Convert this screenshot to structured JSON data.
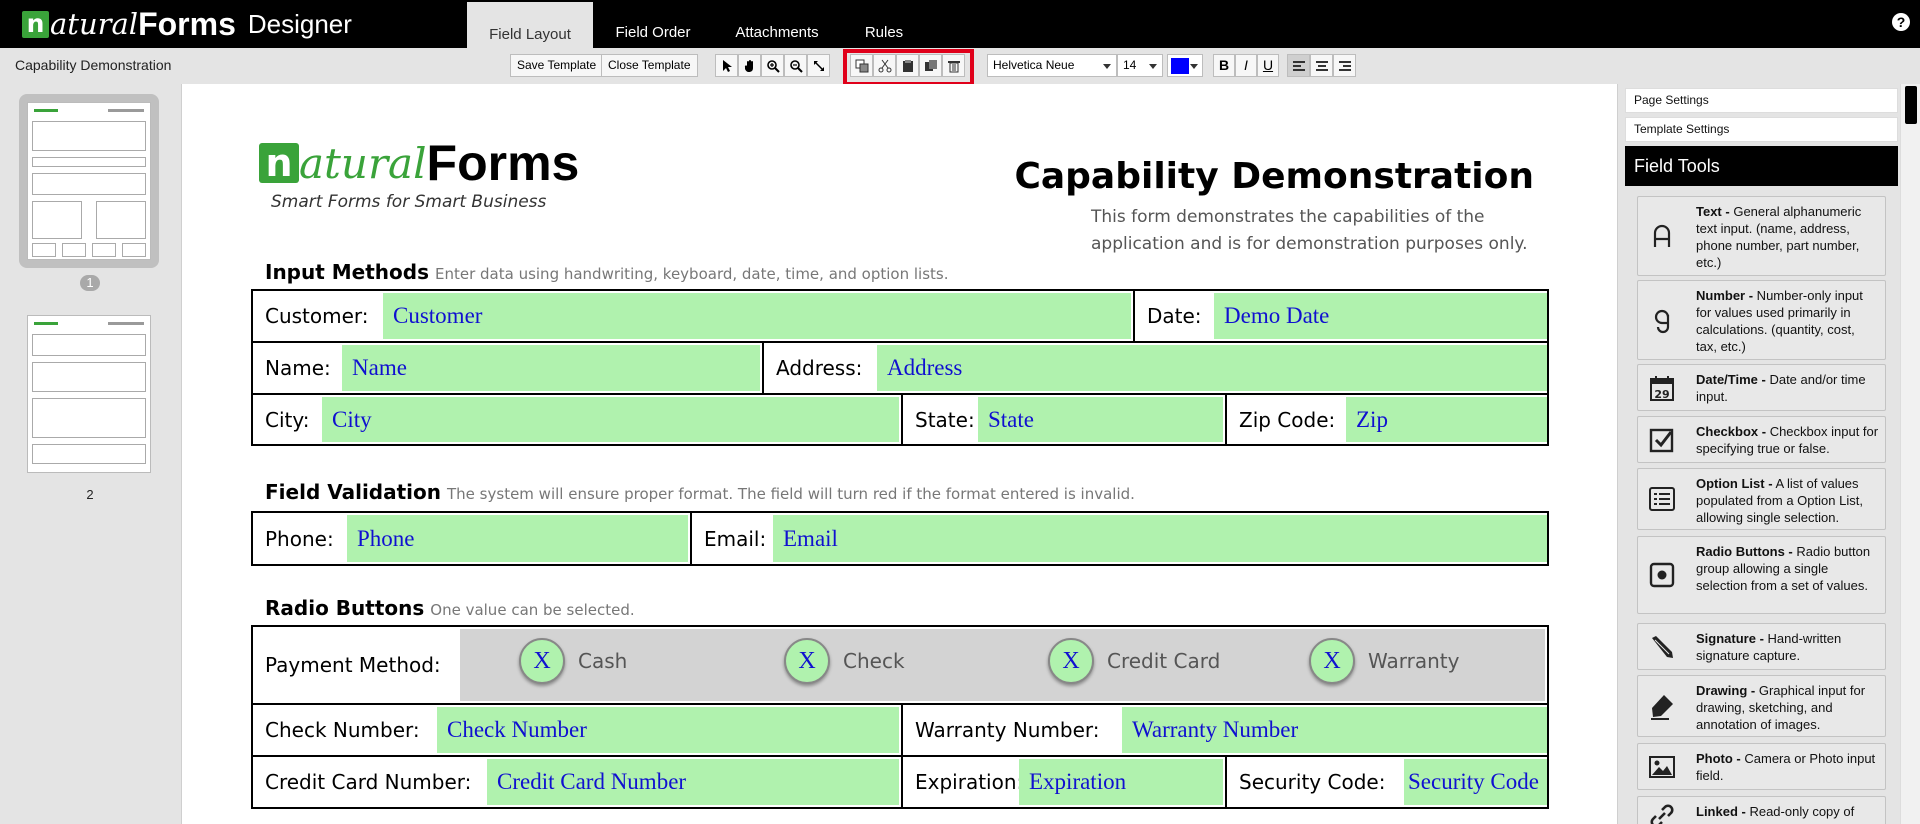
{
  "header": {
    "logo": {
      "n": "n",
      "atural": "atural",
      "forms": "Forms",
      "designer": "Designer"
    },
    "tabs": [
      {
        "label": "Field Layout",
        "active": true
      },
      {
        "label": "Field Order",
        "active": false
      },
      {
        "label": "Attachments",
        "active": false
      },
      {
        "label": "Rules",
        "active": false
      }
    ],
    "help_icon": "question-gear-icon"
  },
  "toolbar": {
    "document_title": "Capability Demonstration",
    "save_template": "Save Template",
    "close_template": "Close Template",
    "tools": [
      "pointer-icon",
      "hand-pan-icon",
      "zoom-in-icon",
      "zoom-out-icon",
      "fit-icon"
    ],
    "edit_tools": [
      "copy-icon",
      "cut-icon",
      "paste-icon",
      "duplicate-icon",
      "delete-icon"
    ],
    "font_family": "Helvetica Neue",
    "font_size": "14",
    "font_color": "#0000ff",
    "bold": "B",
    "italic": "I",
    "underline": "U",
    "align": [
      "align-left-icon",
      "align-center-icon",
      "align-right-icon"
    ]
  },
  "pages": [
    {
      "number": "1",
      "selected": true
    },
    {
      "number": "2",
      "selected": false
    }
  ],
  "form": {
    "logo": {
      "n": "n",
      "atural": "atural",
      "forms": "Forms",
      "tagline": "Smart Forms for Smart Business"
    },
    "title": "Capability Demonstration",
    "description": "This form demonstrates the capabilities of the application and is for demonstration purposes only.",
    "sections": {
      "input_methods": {
        "title": "Input Methods",
        "subtitle": "Enter data using handwriting, keyboard, date, time, and option lists."
      },
      "field_validation": {
        "title": "Field Validation",
        "subtitle": "The system will ensure proper format. The field will turn red if the format entered is invalid."
      },
      "radio_buttons": {
        "title": "Radio Buttons",
        "subtitle": "One value can be selected."
      }
    },
    "fields": {
      "customer": {
        "label": "Customer:",
        "value": "Customer"
      },
      "date": {
        "label": "Date:",
        "value": "Demo Date"
      },
      "name": {
        "label": "Name:",
        "value": "Name"
      },
      "address": {
        "label": "Address:",
        "value": "Address"
      },
      "city": {
        "label": "City:",
        "value": "City"
      },
      "state": {
        "label": "State:",
        "value": "State"
      },
      "zip": {
        "label": "Zip Code:",
        "value": "Zip"
      },
      "phone": {
        "label": "Phone:",
        "value": "Phone"
      },
      "email": {
        "label": "Email:",
        "value": "Email"
      },
      "payment_method": {
        "label": "Payment Method:"
      },
      "check_number": {
        "label": "Check Number:",
        "value": "Check Number"
      },
      "warranty_number": {
        "label": "Warranty Number:",
        "value": "Warranty Number"
      },
      "credit_card_number": {
        "label": "Credit Card Number:",
        "value": "Credit Card Number"
      },
      "expiration": {
        "label": "Expiration:",
        "value": "Expiration"
      },
      "security_code": {
        "label": "Security Code:",
        "value": "Security Code"
      }
    },
    "radio_options": [
      {
        "mark": "X",
        "label": "Cash"
      },
      {
        "mark": "X",
        "label": "Check"
      },
      {
        "mark": "X",
        "label": "Credit Card"
      },
      {
        "mark": "X",
        "label": "Warranty"
      }
    ]
  },
  "right_panel": {
    "page_settings": "Page Settings",
    "template_settings": "Template Settings",
    "field_tools_title": "Field Tools",
    "tools": [
      {
        "icon": "text-tool-icon",
        "name": "Text -",
        "desc": " General alphanumeric text input. (name, address, phone number, part number, etc.)"
      },
      {
        "icon": "number-tool-icon",
        "name": "Number -",
        "desc": " Number-only input for values used primarily in calculations. (quantity, cost, tax, etc.)"
      },
      {
        "icon": "calendar-icon",
        "name": "Date/Time -",
        "desc": " Date and/or time input."
      },
      {
        "icon": "checkbox-icon",
        "name": "Checkbox -",
        "desc": " Checkbox input for specifying true or false."
      },
      {
        "icon": "list-icon",
        "name": "Option List -",
        "desc": " A list of values populated from a Option List, allowing single selection."
      },
      {
        "icon": "radio-icon",
        "name": "Radio Buttons -",
        "desc": " Radio button group allowing a single selection from a set of values."
      },
      {
        "icon": "pen-icon",
        "name": "Signature -",
        "desc": " Hand-written signature capture."
      },
      {
        "icon": "marker-icon",
        "name": "Drawing -",
        "desc": " Graphical input for drawing, sketching, and annotation of images."
      },
      {
        "icon": "photo-icon",
        "name": "Photo -",
        "desc": " Camera or Photo input field."
      },
      {
        "icon": "link-icon",
        "name": "Linked -",
        "desc": " Read-only copy of"
      }
    ]
  }
}
